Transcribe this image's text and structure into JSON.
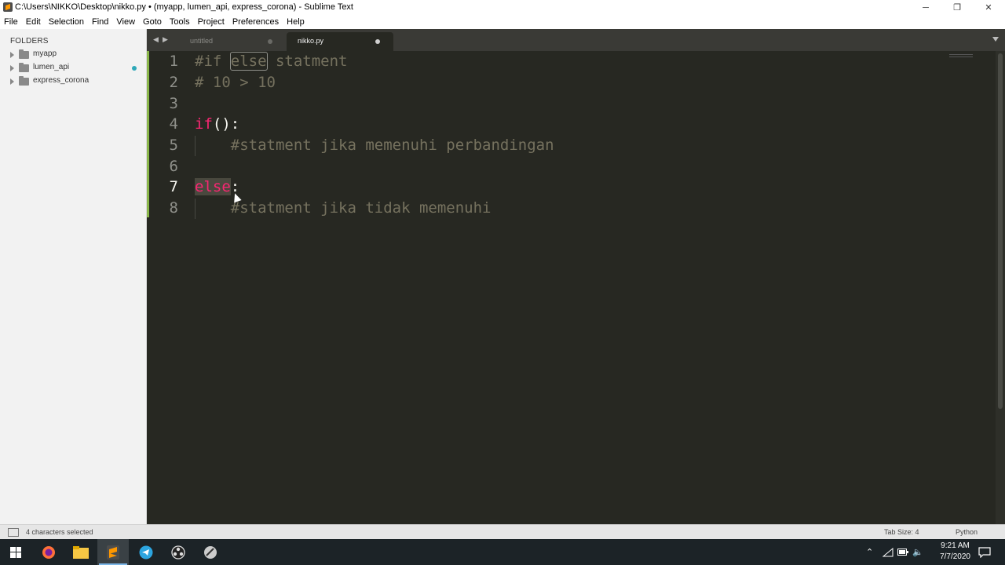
{
  "window": {
    "title": "C:\\Users\\NIKKO\\Desktop\\nikko.py • (myapp, lumen_api, express_corona) - Sublime Text",
    "minimize": "─",
    "restore": "❐",
    "close": "✕"
  },
  "menu": [
    "File",
    "Edit",
    "Selection",
    "Find",
    "View",
    "Goto",
    "Tools",
    "Project",
    "Preferences",
    "Help"
  ],
  "sidebar": {
    "header": "FOLDERS",
    "folders": [
      {
        "name": "myapp"
      },
      {
        "name": "lumen_api"
      },
      {
        "name": "express_corona"
      }
    ]
  },
  "tabs": [
    {
      "label": "untitled",
      "active": false
    },
    {
      "label": "nikko.py",
      "active": true
    }
  ],
  "editor": {
    "lines": [
      {
        "no": "1",
        "parts": [
          "#if ",
          "else",
          " statment"
        ]
      },
      {
        "no": "2",
        "parts": [
          "# 10 > 10"
        ]
      },
      {
        "no": "3",
        "parts": [
          ""
        ]
      },
      {
        "no": "4",
        "parts": [
          "if",
          "():"
        ]
      },
      {
        "no": "5",
        "parts": [
          "    #statment jika memenuhi perbandingan"
        ]
      },
      {
        "no": "6",
        "parts": [
          ""
        ]
      },
      {
        "no": "7",
        "parts": [
          "else",
          ":"
        ]
      },
      {
        "no": "8",
        "parts": [
          "    #statment jika tidak memenuhi"
        ]
      }
    ],
    "current_line": "7"
  },
  "status": {
    "selection": "4 characters selected",
    "tab_size": "Tab Size: 4",
    "syntax": "Python"
  },
  "taskbar": {
    "clock_time": "9:21 AM",
    "clock_date": "7/7/2020"
  },
  "colors": {
    "editor_bg": "#272822",
    "comment": "#75715e",
    "keyword": "#f92672",
    "gutter_modified": "#8ab64a"
  }
}
